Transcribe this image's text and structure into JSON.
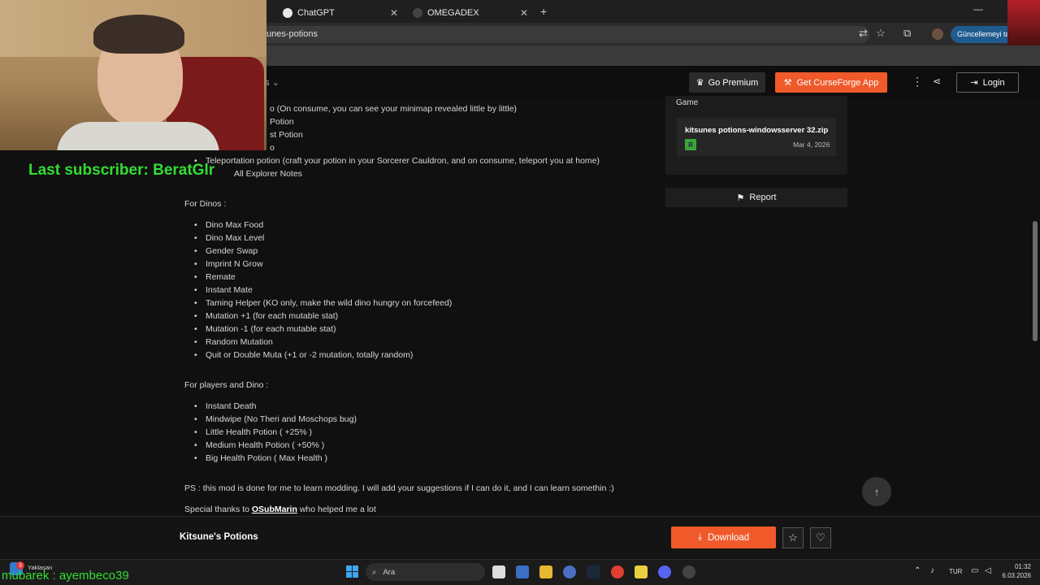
{
  "browser": {
    "tabs": [
      {
        "title": "ChatGPT"
      },
      {
        "title": "OMEGADEX"
      }
    ],
    "url": "unes-potions",
    "update_label": "Güncellemeyi tam"
  },
  "site_header": {
    "nav_label": "os",
    "premium_label": "Go Premium",
    "app_label": "Get CurseForge App",
    "login_label": "Login"
  },
  "stream_overlay": {
    "last_subscriber": "Last subscriber: BeratGlr",
    "chat_line": "mubarek : ayembeco39"
  },
  "description": {
    "partial_items": [
      "o (On consume, you can see your minimap revealed little by little)",
      "Potion",
      "st Potion",
      "o",
      "Teleportation potion (craft your potion in your Sorcerer Cauldron, and on consume, teleport you at home)",
      "All Explorer Notes"
    ],
    "dinos_heading": "For Dinos :",
    "dinos_items": [
      "Dino Max Food",
      "Dino Max Level",
      "Gender Swap",
      "Imprint N Grow",
      "Remate",
      "Instant Mate",
      "Taming Helper (KO only, make the wild dino hungry on forcefeed)",
      "Mutation +1 (for each mutable stat)",
      "Mutation -1 (for each mutable stat)",
      "Random Mutation",
      "Quit or Double Muta (+1 or -2 mutation, totally random)"
    ],
    "players_heading": "For players and Dino :",
    "players_items": [
      "Instant Death",
      "Mindwipe (No Theri and Moschops bug)",
      "Little Health Potion ( +25% )",
      "Medium Health Potion ( +50% )",
      "Big Health Potion ( Max Health )"
    ],
    "ps_text": "PS : this mod is done for me to learn modding. I will add your suggestions if I can do it, and I can learn somethin :)",
    "thanks_prefix": "Special thanks to ",
    "thanks_user": "OSubMarin",
    "thanks_suffix": " who helped me a lot"
  },
  "sidebar": {
    "panel_label": "Game",
    "file_name": "kitsunes potions-windowsserver 32.zip",
    "file_badge": "R",
    "file_date": "Mar 4, 2026",
    "report_label": "Report"
  },
  "footer": {
    "project_name": "Kitsune's Potions",
    "download_label": "Download"
  },
  "taskbar": {
    "weather_badge": "3",
    "weather_label": "Yaklaşan",
    "search_label": "Ara",
    "lang": "TUR",
    "time": "01:32",
    "date": "6.03.2026"
  },
  "colors": {
    "accent": "#f05a2a",
    "overlay_text": "#33dd33",
    "file_badge": "#3aa53a"
  }
}
